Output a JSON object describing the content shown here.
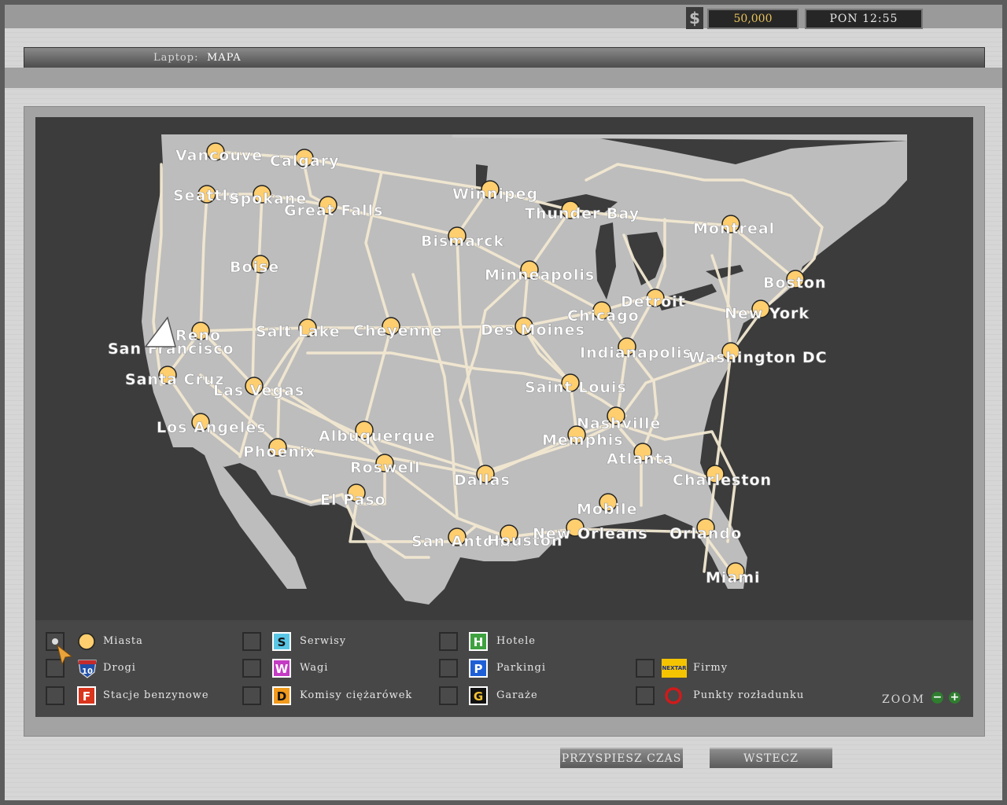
{
  "status_bar": {
    "currency_symbol": "$",
    "money": "50,000",
    "time": "PON 12:55"
  },
  "title": {
    "label": "Laptop:",
    "value": "MAPA"
  },
  "cities": [
    {
      "name": "Vancouver",
      "display": "Vancouve"
    },
    {
      "name": "Calgary",
      "display": "Calgary"
    },
    {
      "name": "Seattle",
      "display": "Seattle"
    },
    {
      "name": "Spokane",
      "display": "Spokane"
    },
    {
      "name": "Great Falls",
      "display": "Great Falls"
    },
    {
      "name": "Winnipeg",
      "display": "Winnipeg"
    },
    {
      "name": "Thunder Bay",
      "display": "Thunder Bay"
    },
    {
      "name": "Montreal",
      "display": "Montreal"
    },
    {
      "name": "Bismarck",
      "display": "Bismarck"
    },
    {
      "name": "Boise",
      "display": "Boise"
    },
    {
      "name": "Minneapolis",
      "display": "Minneapolis"
    },
    {
      "name": "Boston",
      "display": "Boston"
    },
    {
      "name": "Detroit",
      "display": "Detroit"
    },
    {
      "name": "Chicago",
      "display": "Chicago"
    },
    {
      "name": "New York",
      "display": "New York"
    },
    {
      "name": "Reno",
      "display": "Reno"
    },
    {
      "name": "San Francisco",
      "display": "San Francisco"
    },
    {
      "name": "Salt Lake",
      "display": "Salt Lake"
    },
    {
      "name": "Cheyenne",
      "display": "Cheyenne"
    },
    {
      "name": "Des Moines",
      "display": "Des Moines"
    },
    {
      "name": "Indianapolis",
      "display": "Indianapolis"
    },
    {
      "name": "Washington DC",
      "display": "Washington DC"
    },
    {
      "name": "Santa Cruz",
      "display": "Santa Cruz"
    },
    {
      "name": "Las Vegas",
      "display": "Las Vegas"
    },
    {
      "name": "Saint Louis",
      "display": "Saint Louis"
    },
    {
      "name": "Los Angeles",
      "display": "Los Angeles"
    },
    {
      "name": "Albuquerque",
      "display": "Albuquerque"
    },
    {
      "name": "Nashville",
      "display": "Nashville"
    },
    {
      "name": "Memphis",
      "display": "Memphis"
    },
    {
      "name": "Phoenix",
      "display": "Phoenix"
    },
    {
      "name": "Atlanta",
      "display": "Atlanta"
    },
    {
      "name": "Roswell",
      "display": "Roswell"
    },
    {
      "name": "Dallas",
      "display": "Dallas"
    },
    {
      "name": "Charleston",
      "display": "Charleston"
    },
    {
      "name": "El Paso",
      "display": "El Paso"
    },
    {
      "name": "Mobile",
      "display": "Mobile"
    },
    {
      "name": "San Antonio",
      "display": "San Antonio"
    },
    {
      "name": "Houston",
      "display": "Houston"
    },
    {
      "name": "New Orleans",
      "display": "New Orleans"
    },
    {
      "name": "Orlando",
      "display": "Orlando"
    },
    {
      "name": "Miami",
      "display": "Miami"
    }
  ],
  "legend": {
    "items": [
      {
        "label": "Miasta",
        "icon": "city-dot-icon",
        "checked": true
      },
      {
        "label": "Drogi",
        "icon": "interstate-10-icon",
        "icon_text": "10",
        "checked": false
      },
      {
        "label": "Stacje benzynowe",
        "icon": "gas-station-icon",
        "icon_text": "F",
        "checked": false
      },
      {
        "label": "Serwisy",
        "icon": "service-icon",
        "icon_text": "S",
        "checked": false
      },
      {
        "label": "Wagi",
        "icon": "weigh-station-icon",
        "icon_text": "W",
        "checked": false
      },
      {
        "label": "Komisy ciężarówek",
        "icon": "truck-dealer-icon",
        "icon_text": "D",
        "checked": false
      },
      {
        "label": "Hotele",
        "icon": "hotel-icon",
        "icon_text": "H",
        "checked": false
      },
      {
        "label": "Parkingi",
        "icon": "parking-icon",
        "icon_text": "P",
        "checked": false
      },
      {
        "label": "Garaże",
        "icon": "garage-icon",
        "icon_text": "G",
        "checked": false
      },
      {
        "label": "Firmy",
        "icon": "company-logo-icon",
        "icon_text": "NEXTAR",
        "checked": false
      },
      {
        "label": "Punkty rozładunku",
        "icon": "unload-point-icon",
        "checked": false
      }
    ],
    "zoom_label": "ZOOM",
    "zoom_out": "−",
    "zoom_in": "+"
  },
  "buttons": {
    "speed_up": "PRZYSPIESZ CZAS",
    "back": "WSTECZ"
  },
  "colors": {
    "money": "#e8c25a",
    "city_dot": "#ffce6e",
    "road": "#f3e9d2",
    "land": "#bdbdbd",
    "water": "#3c3c3c"
  }
}
